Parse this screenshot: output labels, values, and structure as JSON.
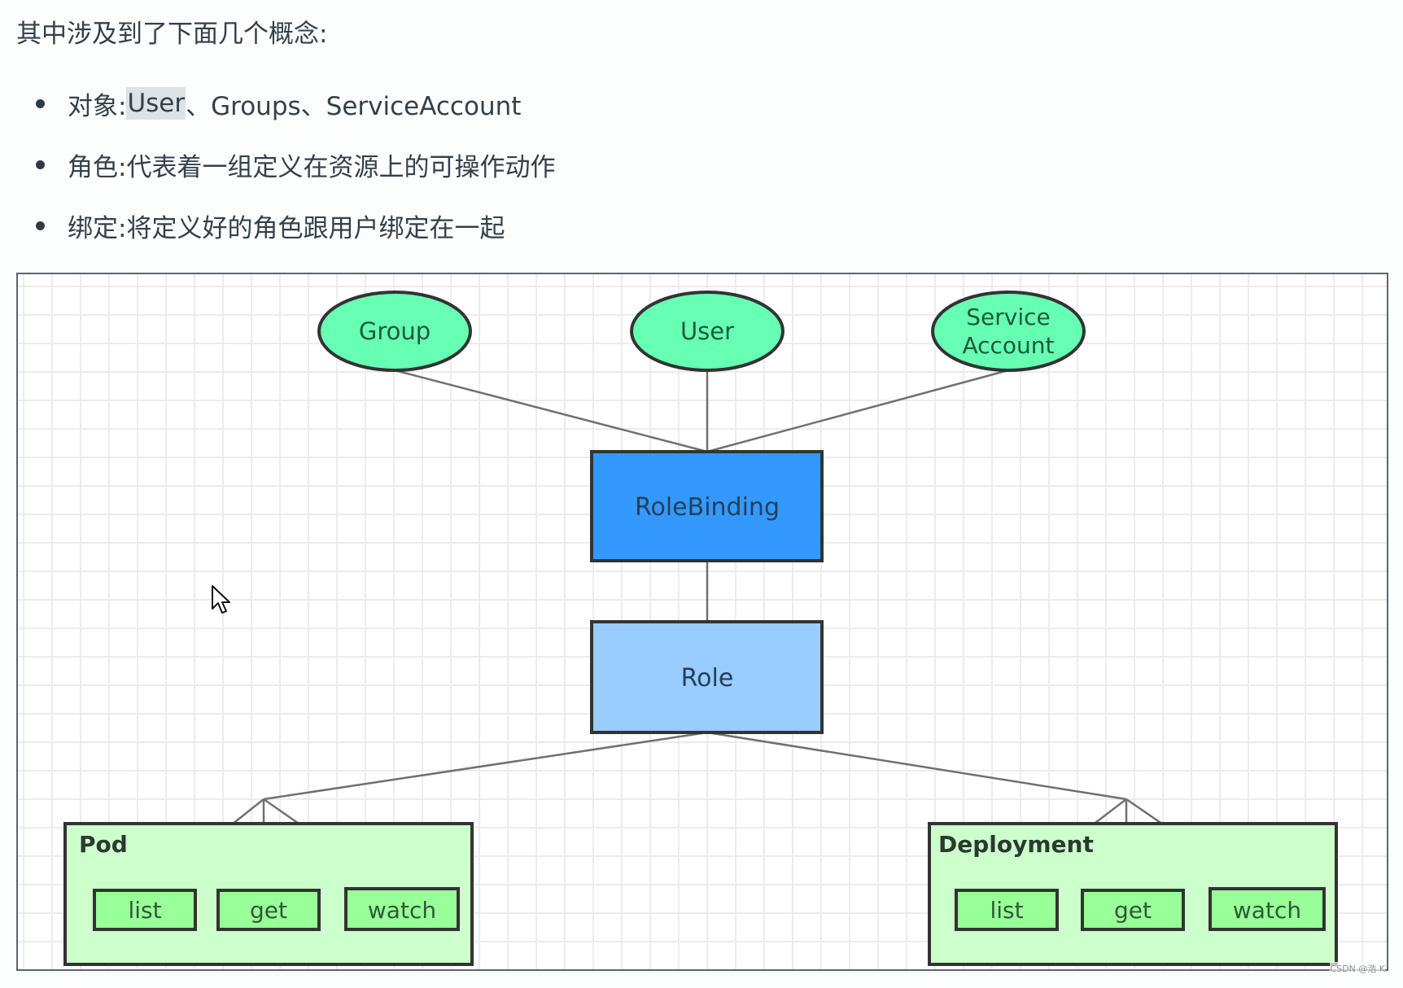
{
  "intro": {
    "title": "其中涉及到了下面几个概念:"
  },
  "bullets": [
    {
      "label": "对象:",
      "highlight": "User",
      "rest": "、Groups、ServiceAccount"
    },
    {
      "label": "角色:",
      "highlight": "",
      "rest": "代表着一组定义在资源上的可操作动作"
    },
    {
      "label": "绑定:",
      "highlight": "",
      "rest": "将定义好的角色跟用户绑定在一起"
    }
  ],
  "diagram": {
    "subjects": [
      {
        "id": "group",
        "label": "Group"
      },
      {
        "id": "user",
        "label": "User"
      },
      {
        "id": "service-account",
        "label_line1": "Service",
        "label_line2": "Account"
      }
    ],
    "role_binding": {
      "label": "RoleBinding"
    },
    "role": {
      "label": "Role"
    },
    "resources": [
      {
        "id": "pod",
        "title": "Pod",
        "verbs": [
          "list",
          "get",
          "watch"
        ]
      },
      {
        "id": "deployment",
        "title": "Deployment",
        "verbs": [
          "list",
          "get",
          "watch"
        ]
      }
    ],
    "colors": {
      "subject_fill": "#66ffb3",
      "role_binding_fill": "#3399ff",
      "role_fill": "#99ccff",
      "resource_fill": "#ccffcc",
      "verb_fill": "#99ff99",
      "stroke": "#333333",
      "edge": "#707070"
    }
  },
  "watermark": "CSDN @浩 K"
}
